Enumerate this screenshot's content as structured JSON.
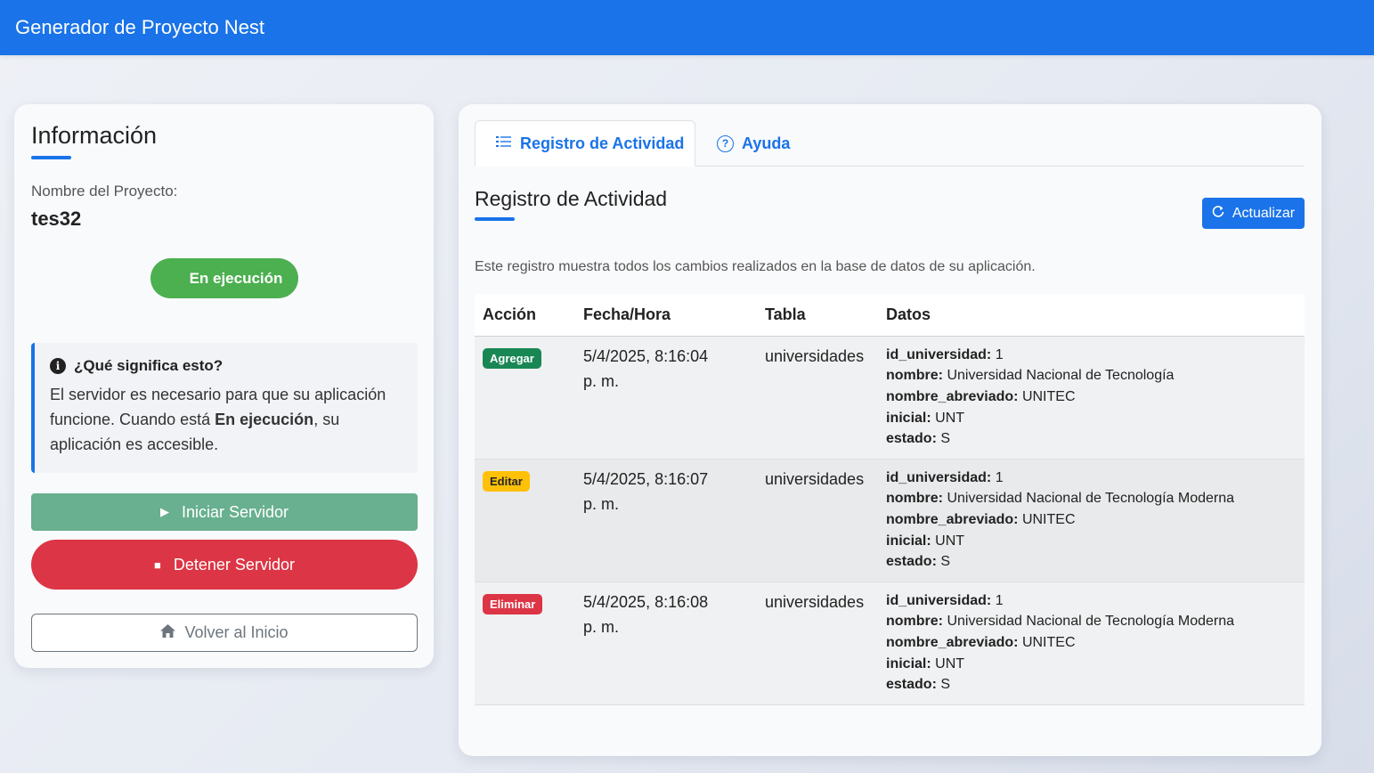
{
  "app": {
    "title": "Generador de Proyecto Nest"
  },
  "info": {
    "title": "Información",
    "project_label": "Nombre del Proyecto:",
    "project_name": "tes32",
    "status": "En ejecución",
    "help_title": "¿Qué significa esto?",
    "help_text_1": "El servidor es necesario para que su aplicación funcione. Cuando está ",
    "help_text_bold": "En ejecución",
    "help_text_2": ", su aplicación es accesible.",
    "start_button": "Iniciar Servidor",
    "stop_button": "Detener Servidor",
    "home_button": "Volver al Inicio"
  },
  "tabs": [
    {
      "label": "Registro de Actividad",
      "icon": "list-icon",
      "active": true
    },
    {
      "label": "Ayuda",
      "icon": "question-circle-icon",
      "active": false
    }
  ],
  "activity": {
    "title": "Registro de Actividad",
    "refresh_button": "Actualizar",
    "description": "Este registro muestra todos los cambios realizados en la base de datos de su aplicación.",
    "headers": [
      "Acción",
      "Fecha/Hora",
      "Tabla",
      "Datos"
    ],
    "rows": [
      {
        "action": "Agregar",
        "action_color": "#198754",
        "action_text_color": "#ffffff",
        "datetime_1": "5/4/2025, 8:16:04",
        "datetime_2": "p. m.",
        "table": "universidades",
        "data": [
          {
            "key": "id_universidad:",
            "value": "1"
          },
          {
            "key": "nombre:",
            "value": "Universidad Nacional de Tecnología"
          },
          {
            "key": "nombre_abreviado:",
            "value": "UNITEC"
          },
          {
            "key": "inicial:",
            "value": "UNT"
          },
          {
            "key": "estado:",
            "value": "S"
          }
        ]
      },
      {
        "action": "Editar",
        "action_color": "#ffc107",
        "action_text_color": "#212529",
        "datetime_1": "5/4/2025, 8:16:07",
        "datetime_2": "p. m.",
        "table": "universidades",
        "data": [
          {
            "key": "id_universidad:",
            "value": "1"
          },
          {
            "key": "nombre:",
            "value": "Universidad Nacional de Tecnología Moderna"
          },
          {
            "key": "nombre_abreviado:",
            "value": "UNITEC"
          },
          {
            "key": "inicial:",
            "value": "UNT"
          },
          {
            "key": "estado:",
            "value": "S"
          }
        ]
      },
      {
        "action": "Eliminar",
        "action_color": "#dc3545",
        "action_text_color": "#ffffff",
        "datetime_1": "5/4/2025, 8:16:08",
        "datetime_2": "p. m.",
        "table": "universidades",
        "data": [
          {
            "key": "id_universidad:",
            "value": "1"
          },
          {
            "key": "nombre:",
            "value": "Universidad Nacional de Tecnología Moderna"
          },
          {
            "key": "nombre_abreviado:",
            "value": "UNITEC"
          },
          {
            "key": "inicial:",
            "value": "UNT"
          },
          {
            "key": "estado:",
            "value": "S"
          }
        ]
      }
    ]
  },
  "colors": {
    "primary": "#1a73e8",
    "running": "#4caf50",
    "start": "#68b08f",
    "stop": "#dc3545"
  }
}
